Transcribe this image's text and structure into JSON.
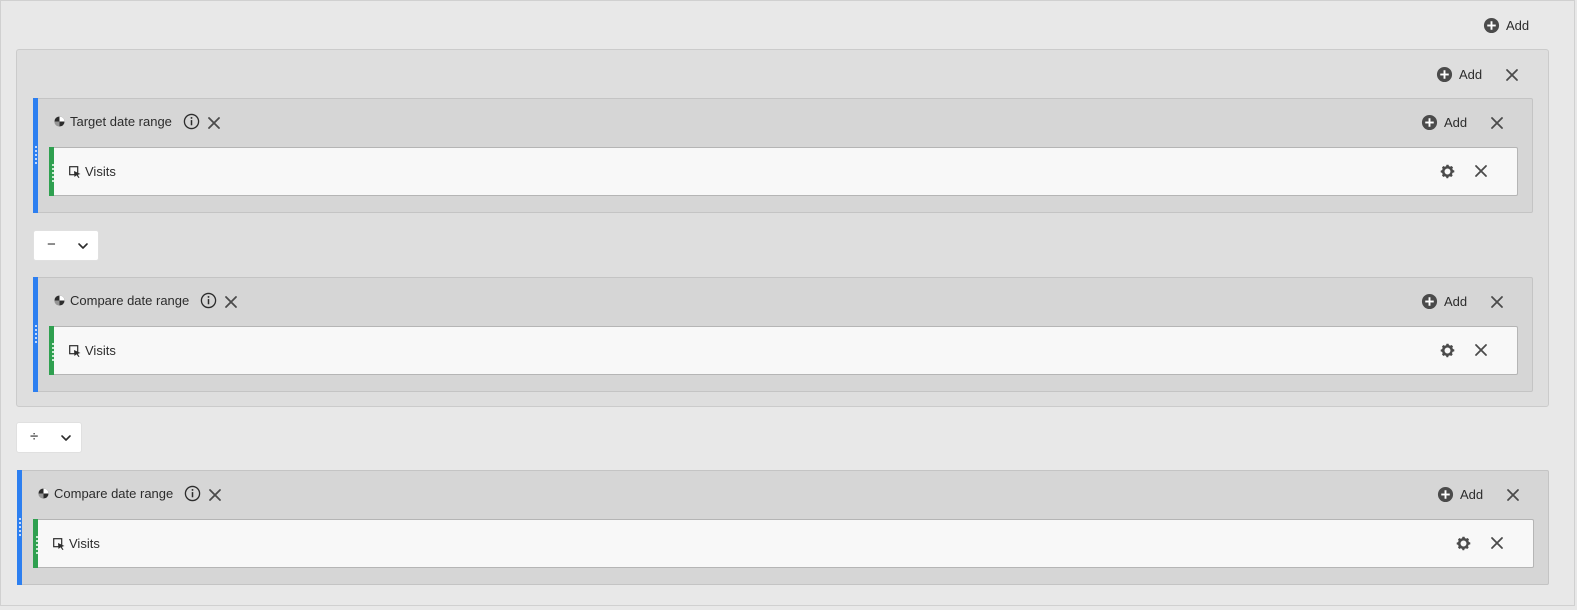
{
  "toolbar": {
    "add_label": "Add"
  },
  "group": {
    "add_label": "Add"
  },
  "containers": [
    {
      "title": "Target date range",
      "add_label": "Add",
      "metric": {
        "label": "Visits"
      }
    },
    {
      "title": "Compare date range",
      "add_label": "Add",
      "metric": {
        "label": "Visits"
      }
    },
    {
      "title": "Compare date range",
      "add_label": "Add",
      "metric": {
        "label": "Visits"
      }
    }
  ],
  "operators": [
    {
      "symbol": "−"
    },
    {
      "symbol": "÷"
    }
  ],
  "icons": {
    "add": "plus-circle-icon",
    "close": "close-icon",
    "settings": "gear-icon",
    "info": "info-icon",
    "segment": "segment-icon",
    "metric": "metric-icon",
    "dropdown": "chevron-down-icon"
  },
  "colors": {
    "container_accent": "#2d7ff0",
    "metric_accent": "#2fa050",
    "background": "#e8e8e8"
  }
}
